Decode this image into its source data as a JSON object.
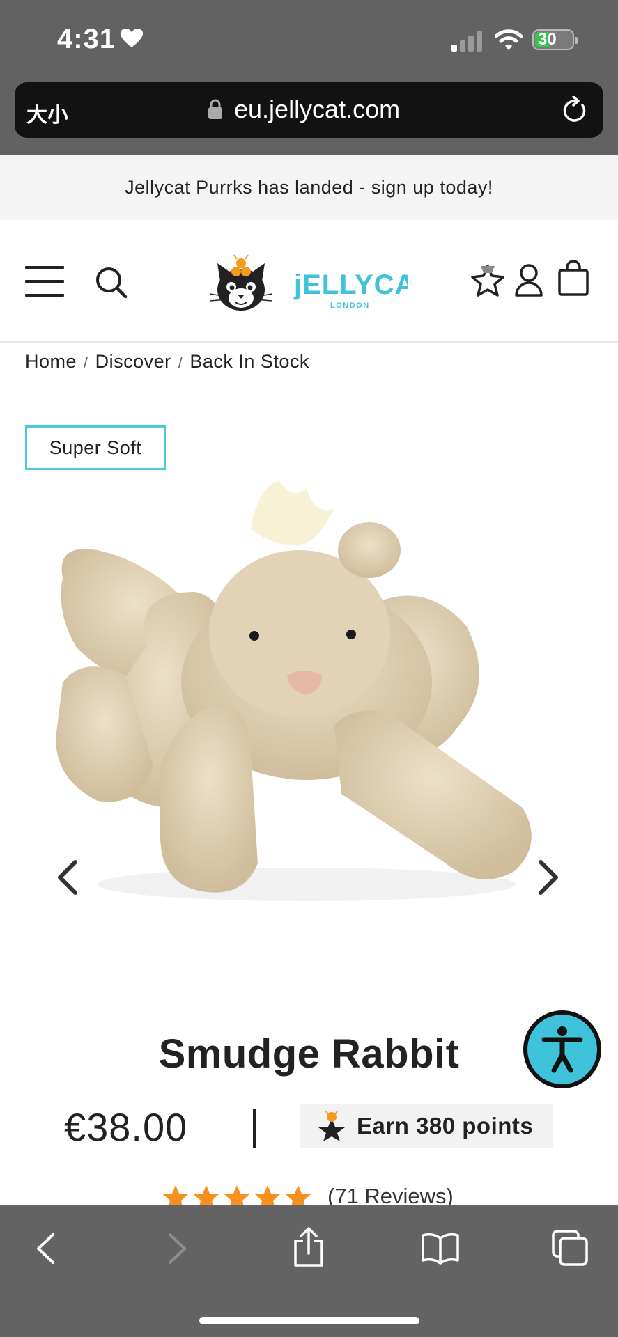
{
  "status_bar": {
    "time": "4:31",
    "battery": "30"
  },
  "address_bar": {
    "text_size_label": "大小",
    "url": "eu.jellycat.com"
  },
  "promo_banner": {
    "text": "Jellycat Purrks has landed - sign up today!"
  },
  "header": {
    "logo_text": "jELLYCAT",
    "logo_subtext": "LONDON"
  },
  "breadcrumb": [
    {
      "label": "Home"
    },
    {
      "label": "Discover"
    },
    {
      "label": "Back In Stock"
    }
  ],
  "product": {
    "badge": "Super Soft",
    "title": "Smudge Rabbit",
    "price": "€38.00",
    "points_label": "Earn 380 points",
    "rating": 5,
    "reviews": "(71 Reviews)"
  },
  "colors": {
    "accent": "#3ec3db",
    "star": "#f7901e",
    "logo_orange": "#f39a1f"
  },
  "icons": [
    "heart-icon",
    "signal-icon",
    "wifi-icon",
    "lock-icon",
    "reload-icon",
    "menu-icon",
    "search-icon",
    "wishlist-star-icon",
    "account-icon",
    "bag-icon",
    "chevron-left-icon",
    "chevron-right-icon",
    "accessibility-icon",
    "share-icon",
    "bookmarks-icon",
    "tabs-icon"
  ]
}
